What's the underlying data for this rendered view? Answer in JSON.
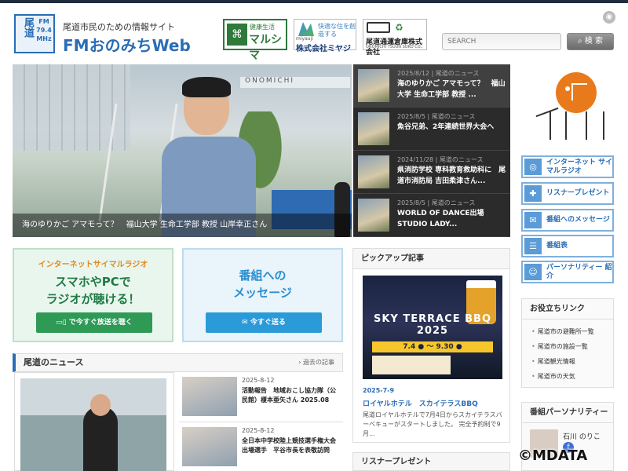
{
  "header": {
    "logo_vertical": "尾道",
    "logo_fm": "FM\n79.4\nMHz",
    "site_subtitle": "尾道市民のための情報サイト",
    "site_title": "FMおのみちWeb",
    "search_placeholder": "SEARCH",
    "search_button": "検 索"
  },
  "sponsors": [
    {
      "top": "健康生活",
      "name": "マルシマ"
    },
    {
      "brand": "miyauji",
      "tagline": "快適な住を創造する",
      "name": "株式会社ミヤジ"
    },
    {
      "name": "尾道通運倉庫株式会社",
      "english": "ONOMICHI TSUUN SOKO CO., LTD."
    }
  ],
  "hero": {
    "sign_text": "ONOMICHI",
    "caption": "海のゆりかご アマモって？　福山大学 生命工学部 教授 山岸幸正さん",
    "items": [
      {
        "date": "2025/8/12",
        "category": "尾道のニュース",
        "title": "海のゆりかご アマモって？　福山大学 生命工学部 教授 ..."
      },
      {
        "date": "2025/8/5",
        "category": "尾道のニュース",
        "title": "魚谷兄弟、2年連続世界大会へ"
      },
      {
        "date": "2024/11/28",
        "category": "尾道のニュース",
        "title": "県消防学校 専科教育救助科に　尾道市消防局 吉田柔津さん..."
      },
      {
        "date": "2025/8/5",
        "category": "尾道のニュース",
        "title": "WORLD OF DANCE出場 STUDIO LADY..."
      }
    ]
  },
  "side_buttons": [
    {
      "label": "インターネット サイマルラジオ",
      "icon": "radio-icon"
    },
    {
      "label": "リスナープレゼント",
      "icon": "gift-icon"
    },
    {
      "label": "番組へのメッセージ",
      "icon": "mail-icon"
    },
    {
      "label": "番組表",
      "icon": "schedule-icon"
    },
    {
      "label": "パーソナリティー 紹介",
      "icon": "people-icon"
    }
  ],
  "useful_links": {
    "title": "お役立ちリンク",
    "items": [
      "尾道市の避難所一覧",
      "尾道市の施設一覧",
      "尾道観光情報",
      "尾道市の天気"
    ]
  },
  "personality": {
    "title": "番組パーソナリティー",
    "name": "石川 のりこ"
  },
  "promo_radio": {
    "line1": "インターネットサイマルラジオ",
    "line2": "スマホやPCで",
    "line3": "ラジオが聴ける！",
    "button": "で今すぐ放送を聴く"
  },
  "promo_message": {
    "line1": "番組への",
    "line2": "メッセージ",
    "button": "今すぐ送る"
  },
  "news": {
    "title": "尾道のニュース",
    "more": "過去の記事",
    "items": [
      {
        "date": "2025-8-12",
        "title": "活動報告　地域おこし協力隊（公民館）榎本亜矢さん 2025.08"
      },
      {
        "date": "2025-8-12",
        "title": "全日本中学校陸上競技選手権大会出場選手　平谷市長を表敬訪問"
      }
    ]
  },
  "pickup": {
    "title": "ピックアップ記事",
    "poster_event": "SKY TERRACE BBQ 2025",
    "poster_dates": "7.4 ● 〜 9.30 ●",
    "date": "2025-7-9",
    "article_title": "ロイヤルホテル　スカイテラスBBQ",
    "desc": "尾道ロイヤルホテルで7月4日からスカイテラスバーベキューがスタートしました。 完全予約制で9月..."
  },
  "present": {
    "title": "リスナープレゼント"
  },
  "watermark": "©MDATA"
}
